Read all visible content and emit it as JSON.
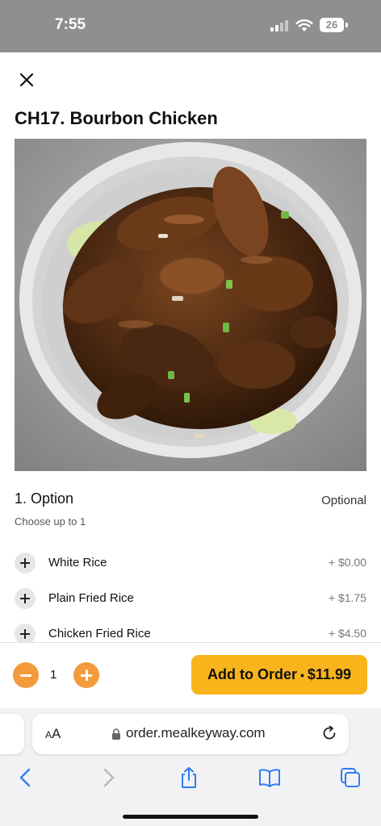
{
  "status_bar": {
    "time": "7:55",
    "battery": "26"
  },
  "item": {
    "title": "CH17. Bourbon Chicken",
    "image_alt": "Bourbon chicken in a white bowl"
  },
  "option_group": {
    "title": "1. Option",
    "badge": "Optional",
    "subtitle": "Choose up to 1",
    "options": [
      {
        "name": "White Rice",
        "price": "+ $0.00"
      },
      {
        "name": "Plain Fried Rice",
        "price": "+ $1.75"
      },
      {
        "name": "Chicken Fried Rice",
        "price": "+ $4.50"
      }
    ]
  },
  "order": {
    "quantity": "1",
    "add_label": "Add to Order",
    "separator": "•",
    "price": "$11.99"
  },
  "browser": {
    "aa_small": "A",
    "aa_large": "A",
    "url": "order.mealkeyway.com"
  },
  "colors": {
    "accent_orange": "#f39a3c",
    "add_button": "#f8b41a",
    "ios_blue": "#2f7cf6"
  }
}
